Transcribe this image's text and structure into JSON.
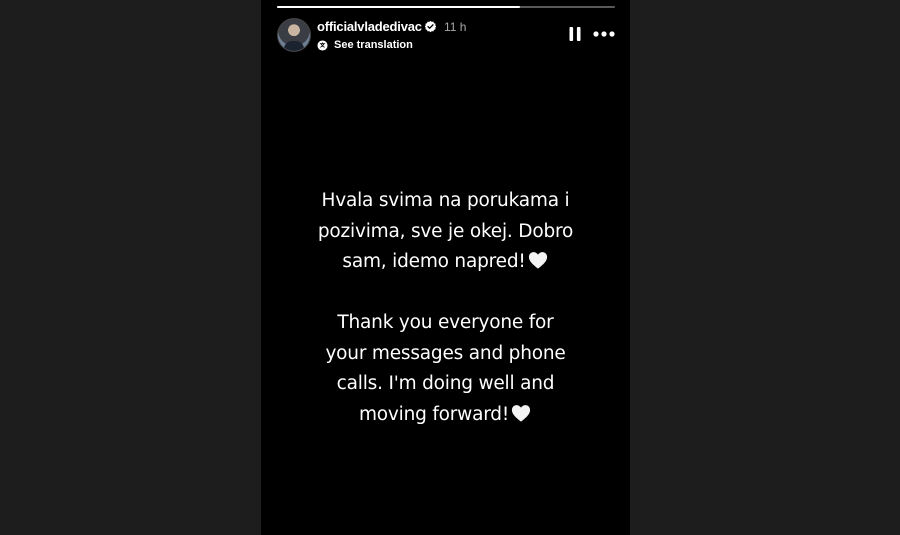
{
  "story": {
    "progress_fraction": 0.72,
    "username": "officialvladedivac",
    "verified_icon": "verified-badge-icon",
    "time_ago": "11 h",
    "translate_label": "See translation",
    "pause_icon": "pause-icon",
    "more_icon": "more-options-icon"
  },
  "message": {
    "serbian_lines": [
      "Hvala svima na porukama i",
      "pozivima, sve je okej. Dobro",
      "sam, idemo napred!"
    ],
    "english_lines": [
      "Thank you everyone for",
      "your messages and phone",
      "calls. I'm doing well and",
      "moving forward!"
    ],
    "heart_icon": "white-heart-icon"
  },
  "colors": {
    "page_background": "#1d1d1d",
    "story_background": "#000000",
    "text": "#ffffff"
  }
}
